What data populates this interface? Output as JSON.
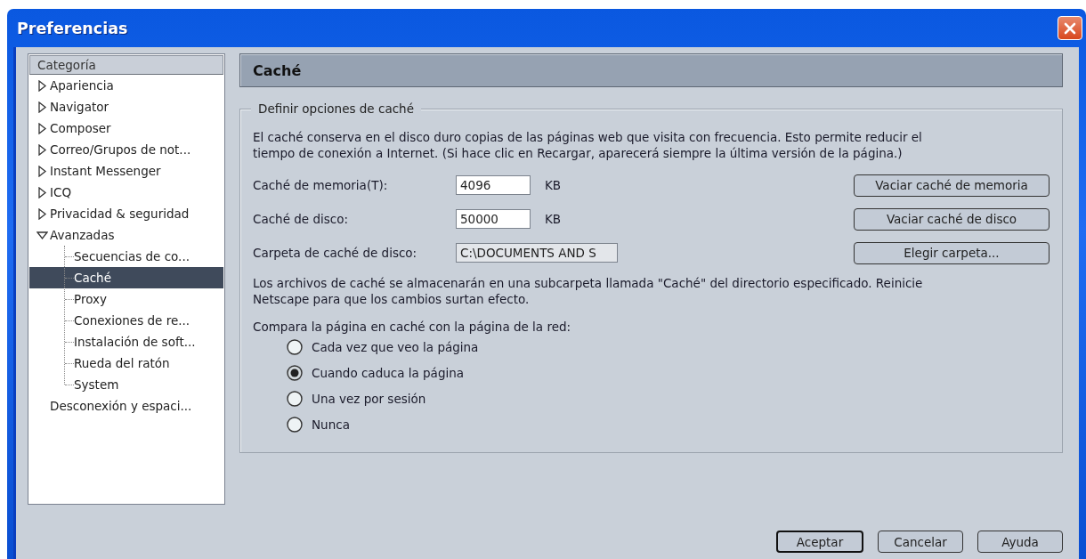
{
  "window": {
    "title": "Preferencias"
  },
  "sidebar": {
    "header": "Categoría",
    "items": [
      {
        "label": "Apariencia",
        "expanded": false,
        "selected": false
      },
      {
        "label": "Navigator",
        "expanded": false,
        "selected": false
      },
      {
        "label": "Composer",
        "expanded": false,
        "selected": false
      },
      {
        "label": "Correo/Grupos de not...",
        "expanded": false,
        "selected": false
      },
      {
        "label": "Instant Messenger",
        "expanded": false,
        "selected": false
      },
      {
        "label": "ICQ",
        "expanded": false,
        "selected": false
      },
      {
        "label": "Privacidad & seguridad",
        "expanded": false,
        "selected": false
      },
      {
        "label": "Avanzadas",
        "expanded": true,
        "selected": false,
        "children": [
          {
            "label": "Secuencias de co...",
            "selected": false
          },
          {
            "label": "Caché",
            "selected": true
          },
          {
            "label": "Proxy",
            "selected": false
          },
          {
            "label": "Conexiones de re...",
            "selected": false
          },
          {
            "label": "Instalación de soft...",
            "selected": false
          },
          {
            "label": "Rueda del ratón",
            "selected": false
          },
          {
            "label": "System",
            "selected": false
          }
        ]
      },
      {
        "label": "Desconexión y espaci...",
        "selected": false
      }
    ]
  },
  "panel": {
    "title": "Caché",
    "group": {
      "legend": "Definir opciones de caché",
      "description": "El caché conserva en el disco duro copias de las páginas web que visita con frecuencia. Esto permite reducir el tiempo de conexión a Internet. (Si hace clic en Recargar, aparecerá siempre la última versión de la página.)",
      "fields": [
        {
          "label": "Caché de memoria(T):",
          "value": "4096",
          "unit": "KB",
          "button": "Vaciar caché de memoria",
          "disabled": false
        },
        {
          "label": "Caché de disco:",
          "value": "50000",
          "unit": "KB",
          "button": "Vaciar caché de disco",
          "disabled": false
        },
        {
          "label": "Carpeta de caché de disco:",
          "value": "C:\\DOCUMENTS AND S",
          "button": "Elegir carpeta...",
          "disabled": true
        }
      ],
      "note": "Los archivos de caché se almacenarán en una subcarpeta llamada \"Caché\" del directorio especificado. Reinicie Netscape para que los cambios surtan efecto.",
      "compare_label": "Compara la página en caché con la página de la red:",
      "options": [
        {
          "label": "Cada vez que veo la página",
          "selected": false
        },
        {
          "label": "Cuando caduca la página",
          "selected": true
        },
        {
          "label": "Una vez por sesión",
          "selected": false
        },
        {
          "label": "Nunca",
          "selected": false
        }
      ]
    }
  },
  "buttons": [
    {
      "label": "Aceptar",
      "default": true
    },
    {
      "label": "Cancelar",
      "default": false
    },
    {
      "label": "Ayuda",
      "default": false
    }
  ]
}
